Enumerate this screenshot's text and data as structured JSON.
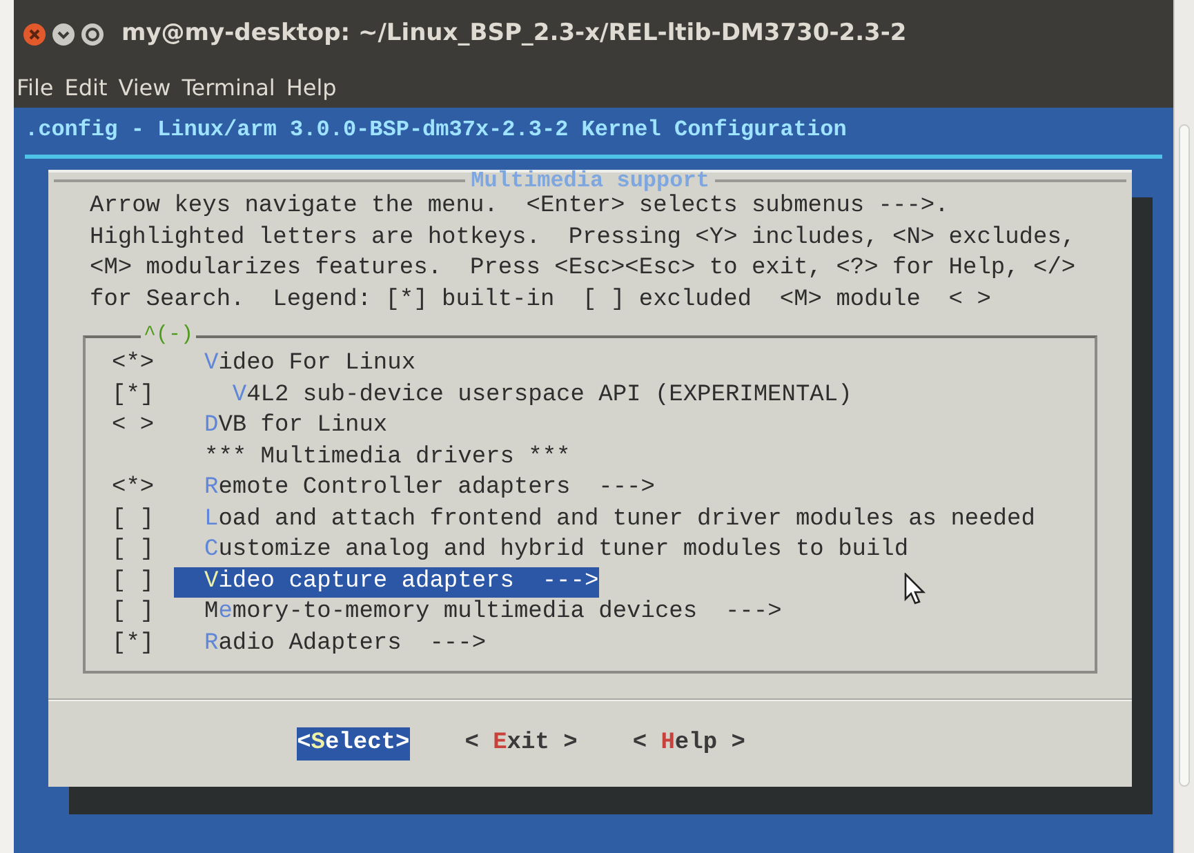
{
  "window": {
    "title": "my@my-desktop: ~/Linux_BSP_2.3-x/REL-ltib-DM3730-2.3-2"
  },
  "menu_bar": [
    "File",
    "Edit",
    "View",
    "Terminal",
    "Help"
  ],
  "terminal": {
    "header": ".config - Linux/arm 3.0.0-BSP-dm37x-2.3-2 Kernel Configuration",
    "dialog": {
      "title": "Multimedia support",
      "help_lines": [
        "Arrow keys navigate the menu.  <Enter> selects submenus --->.",
        "Highlighted letters are hotkeys.  Pressing <Y> includes, <N> excludes,",
        "<M> modularizes features.  Press <Esc><Esc> to exit, <?> for Help, </>",
        "for Search.  Legend: [*] built-in  [ ] excluded  <M> module  < >"
      ],
      "scroll_indicator": "^(-)",
      "items": [
        {
          "prompt": "<*>",
          "selected": false,
          "segments": [
            {
              "text": "V",
              "hotkey": true
            },
            {
              "text": "ideo For Linux",
              "hotkey": false
            }
          ],
          "children": [
            {
              "prompt": "[*]",
              "selected": false,
              "segments": [
                {
                  "text": "V",
                  "hotkey": true
                },
                {
                  "text": "4L2 sub-device userspace API (EXPERIMENTAL)",
                  "hotkey": false
                }
              ]
            }
          ]
        },
        {
          "prompt": "< >",
          "selected": false,
          "segments": [
            {
              "text": "D",
              "hotkey": true
            },
            {
              "text": "VB for Linux",
              "hotkey": false
            }
          ]
        },
        {
          "selected": false,
          "segments": [
            {
              "text": "*** Multimedia drivers ***",
              "hotkey": false
            }
          ]
        },
        {
          "prompt": "<*>",
          "selected": false,
          "segments": [
            {
              "text": "R",
              "hotkey": true
            },
            {
              "text": "emote Controller adapters  --->",
              "hotkey": false
            }
          ]
        },
        {
          "prompt": "[ ]",
          "selected": false,
          "segments": [
            {
              "text": "L",
              "hotkey": true
            },
            {
              "text": "oad and attach frontend and tuner driver modules as needed",
              "hotkey": false
            }
          ]
        },
        {
          "prompt": "[ ]",
          "selected": false,
          "segments": [
            {
              "text": "C",
              "hotkey": true
            },
            {
              "text": "ustomize analog and hybrid tuner modules to build",
              "hotkey": false
            }
          ]
        },
        {
          "prompt": "[ ]",
          "selected": true,
          "segments": [
            {
              "text": "V",
              "hotkey": true
            },
            {
              "text": "ideo capture adapters  --->",
              "hotkey": false
            }
          ]
        },
        {
          "prompt": "[ ]",
          "selected": false,
          "segments": [
            {
              "text": "M",
              "hotkey": false
            },
            {
              "text": "e",
              "hotkey": true
            },
            {
              "text": "mory-to-memory multimedia devices  --->",
              "hotkey": false
            }
          ]
        },
        {
          "prompt": "[*]",
          "selected": false,
          "segments": [
            {
              "text": "R",
              "hotkey": true
            },
            {
              "text": "adio Adapters  --->",
              "hotkey": false
            }
          ]
        }
      ],
      "buttons": [
        {
          "selected": true,
          "segments": [
            {
              "text": "<",
              "hotkey": false
            },
            {
              "text": "S",
              "hotkey": true
            },
            {
              "text": "elect>",
              "hotkey": false
            }
          ]
        },
        {
          "selected": false,
          "segments": [
            {
              "text": "< ",
              "hotkey": false
            },
            {
              "text": "E",
              "hotkey": true
            },
            {
              "text": "xit >",
              "hotkey": false
            }
          ]
        },
        {
          "selected": false,
          "segments": [
            {
              "text": "< ",
              "hotkey": false
            },
            {
              "text": "H",
              "hotkey": true
            },
            {
              "text": "elp >",
              "hotkey": false
            }
          ]
        }
      ]
    }
  }
}
